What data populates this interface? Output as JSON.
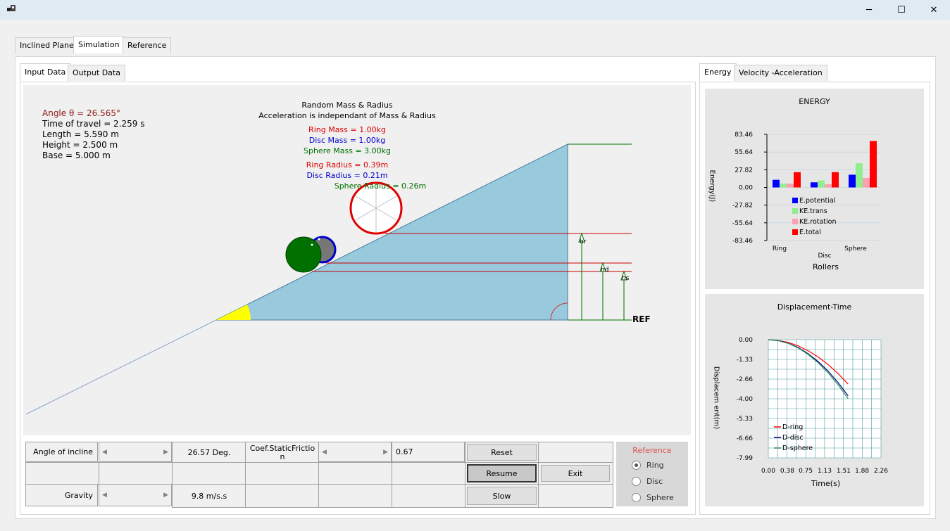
{
  "window": {
    "minimize": "─",
    "maximize": "☐",
    "close": "✕"
  },
  "main_tabs": [
    "Inclined Plane",
    "Simulation",
    "Reference"
  ],
  "input_tabs": [
    "Input Data",
    "Output Data"
  ],
  "chart_tabs": [
    "Energy",
    "Velocity -Acceleration"
  ],
  "info": {
    "angle": "Angle θ = 26.565°",
    "time": "Time of travel = 2.259 s",
    "length": "Length = 5.590 m",
    "height": "Height = 2.500 m",
    "base": "Base = 5.000 m"
  },
  "center_info": {
    "title1": "Random Mass & Radius",
    "title2": "Acceleration is independant of Mass & Radius",
    "ring_mass": "Ring Mass = 1.00kg",
    "disc_mass": "Disc Mass = 1.00kg",
    "sphere_mass": "Sphere Mass = 3.00kg",
    "ring_radius": "Ring Radius = 0.39m",
    "disc_radius": "Disc Radius = 0.21m",
    "sphere_radius": "Sphere Radius = 0.26m"
  },
  "plot_labels": {
    "hr": "hr",
    "hd": "hd",
    "hs": "hs",
    "ref": "REF"
  },
  "controls": {
    "angle_label": "Angle of incline",
    "angle_value": "26.57 Deg.",
    "friction_label": "Coef.StaticFrictio\nn",
    "friction_value": "0.67",
    "gravity_label": "Gravity",
    "gravity_value": "9.8 m/s.s",
    "slider_left": "◀",
    "slider_right": "▶",
    "reset": "Reset",
    "resume": "Resume",
    "exit": "Exit",
    "slow": "Slow"
  },
  "reference": {
    "title": "Reference",
    "options": [
      "Ring",
      "Disc",
      "Sphere"
    ],
    "selected": "Ring"
  },
  "colors": {
    "ring": "#e00000",
    "disc": "#0000cc",
    "sphere": "#007000",
    "incline": "#99c9dd",
    "angle": "#ffff00"
  },
  "chart_data": [
    {
      "type": "bar",
      "title": "ENERGY",
      "xlabel": "Rollers",
      "ylabel": "Energy(J)",
      "categories": [
        "Ring",
        "Disc",
        "Sphere"
      ],
      "yticks": [
        "83.46",
        "55.64",
        "27.82",
        "0.00",
        "-27.82",
        "-55.64",
        "-83.46"
      ],
      "ylim": [
        -83.46,
        83.46
      ],
      "series": [
        {
          "name": "E.potential",
          "color": "#0000ff",
          "values": [
            12,
            8,
            20
          ]
        },
        {
          "name": "KE.trans",
          "color": "#90ee90",
          "values": [
            6,
            11,
            38
          ]
        },
        {
          "name": "KE.rotation",
          "color": "#ffa0b0",
          "values": [
            6,
            5,
            15
          ]
        },
        {
          "name": "E.total",
          "color": "#ff0000",
          "values": [
            24,
            24,
            73
          ]
        }
      ],
      "legend": "inside-center"
    },
    {
      "type": "line",
      "title": "Displacement-Time",
      "xlabel": "Time(s)",
      "ylabel": "Displacem ent(m)",
      "xticks": [
        "0.00",
        "0.38",
        "0.75",
        "1.13",
        "1.51",
        "1.88",
        "2.26"
      ],
      "yticks": [
        "0.00",
        "-1.33",
        "-2.66",
        "-4.00",
        "-5.33",
        "-6.66",
        "-7.99"
      ],
      "xlim": [
        0,
        2.26
      ],
      "ylim": [
        -7.99,
        0
      ],
      "series": [
        {
          "name": "D-ring",
          "color": "#ff0000",
          "x": [
            0,
            0.2,
            0.4,
            0.6,
            0.8,
            1.0,
            1.2,
            1.4,
            1.6
          ],
          "y": [
            0,
            -0.05,
            -0.18,
            -0.42,
            -0.75,
            -1.17,
            -1.68,
            -2.29,
            -3.0
          ]
        },
        {
          "name": "D-disc",
          "color": "#000080",
          "x": [
            0,
            0.2,
            0.4,
            0.6,
            0.8,
            1.0,
            1.2,
            1.4,
            1.6
          ],
          "y": [
            0,
            -0.06,
            -0.24,
            -0.53,
            -0.95,
            -1.48,
            -2.13,
            -2.9,
            -3.8
          ]
        },
        {
          "name": "D-sphere",
          "color": "#2e8b57",
          "x": [
            0,
            0.2,
            0.4,
            0.6,
            0.8,
            1.0,
            1.2,
            1.4,
            1.6
          ],
          "y": [
            0,
            -0.07,
            -0.25,
            -0.56,
            -1.0,
            -1.56,
            -2.24,
            -3.05,
            -3.98
          ]
        }
      ],
      "legend": "bottom-left"
    }
  ]
}
